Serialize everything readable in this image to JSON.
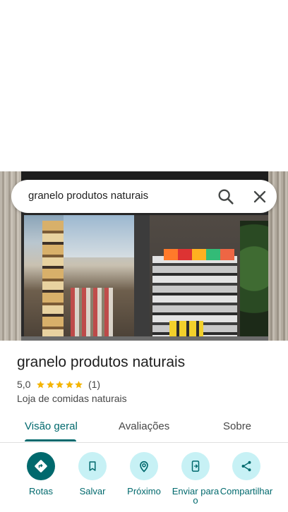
{
  "search": {
    "query": "granelo produtos naturais",
    "search_icon": "search-icon",
    "clear_icon": "close-icon"
  },
  "place": {
    "name": "granelo produtos naturais",
    "rating": "5,0",
    "stars": 5,
    "review_count": "(1)",
    "category": "Loja de comidas naturais"
  },
  "tabs": [
    {
      "label": "Visão geral",
      "active": true
    },
    {
      "label": "Avaliações",
      "active": false
    },
    {
      "label": "Sobre",
      "active": false
    }
  ],
  "actions": [
    {
      "label": "Rotas",
      "icon": "directions-icon"
    },
    {
      "label": "Salvar",
      "icon": "bookmark-icon"
    },
    {
      "label": "Próximo",
      "icon": "nearby-icon"
    },
    {
      "label": "Enviar para o",
      "icon": "send-to-phone-icon"
    },
    {
      "label": "Compartilhar",
      "icon": "share-icon"
    }
  ],
  "colors": {
    "accent": "#00696d",
    "action_bg": "#c7f1f5",
    "star": "#f4b400"
  }
}
